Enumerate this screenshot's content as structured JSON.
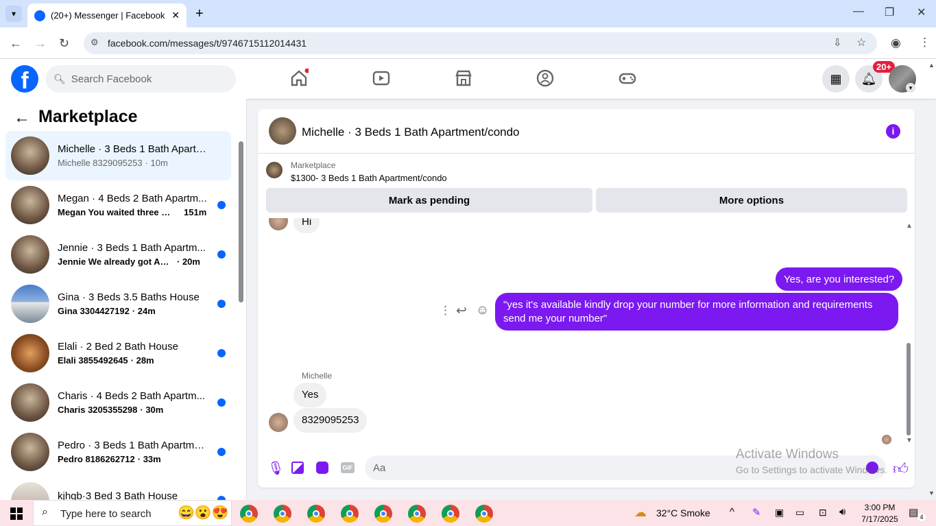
{
  "browser": {
    "tab_title": "(20+) Messenger | Facebook",
    "url": "facebook.com/messages/t/9746715112014431"
  },
  "header": {
    "search_placeholder": "Search Facebook",
    "notif_badge": "20+"
  },
  "sidebar": {
    "title": "Marketplace",
    "conversations": [
      {
        "title": "Michelle · 3 Beds 1 Bath Apartm...",
        "preview": "Michelle 8329095253",
        "time": "· 10m",
        "unread": false,
        "selected": true
      },
      {
        "title": "Megan · 4 Beds 2 Bath Apartm...",
        "preview": "Megan You waited three mo...",
        "time": "151m",
        "unread": true
      },
      {
        "title": "Jennie · 3 Beds 1 Bath Apartm...",
        "preview": "Jennie We already got Apartm...",
        "time": "· 20m",
        "unread": true
      },
      {
        "title": "Gina · 3 Beds 3.5 Baths House",
        "preview": "Gina 3304427192",
        "time": "· 24m",
        "unread": true
      },
      {
        "title": "Elali · 2 Bed 2 Bath House",
        "preview": "Elali 3855492645",
        "time": "· 28m",
        "unread": true
      },
      {
        "title": "Charis · 4 Beds 2 Bath Apartm...",
        "preview": "Charis 3205355298",
        "time": "· 30m",
        "unread": true
      },
      {
        "title": "Pedro · 3 Beds 1 Bath Apartme...",
        "preview": "Pedro 8186262712",
        "time": "· 33m",
        "unread": true
      },
      {
        "title": "kjhgb·3 Bed 3 Bath House",
        "preview": "",
        "time": "",
        "unread": true
      }
    ]
  },
  "chat": {
    "title": "Michelle · 3 Beds 1 Bath Apartment/condo",
    "listing_label": "Marketplace",
    "listing_title": "$1300- 3 Beds 1 Bath Apartment/condo",
    "mark_pending": "Mark as pending",
    "more_options": "More options",
    "partial_msg": "Hi",
    "msg_out_1": "Yes, are you interested?",
    "msg_out_2": "\"yes it's available kindly drop your number for more information and requirements send me your number\"",
    "sender_name": "Michelle",
    "msg_in_1": "Yes",
    "msg_in_2": "8329095253",
    "composer_placeholder": "Aa"
  },
  "watermark": {
    "line1": "Activate Windows",
    "line2": "Go to Settings to activate Windows."
  },
  "taskbar": {
    "search": "Type here to search",
    "weather": "32°C  Smoke",
    "time": "3:00 PM",
    "date": "7/17/2025",
    "notif_count": "4"
  },
  "colors": {
    "fb_blue": "#0866ff",
    "messenger_purple": "#7b19f0",
    "badge_red": "#e41e3f"
  }
}
